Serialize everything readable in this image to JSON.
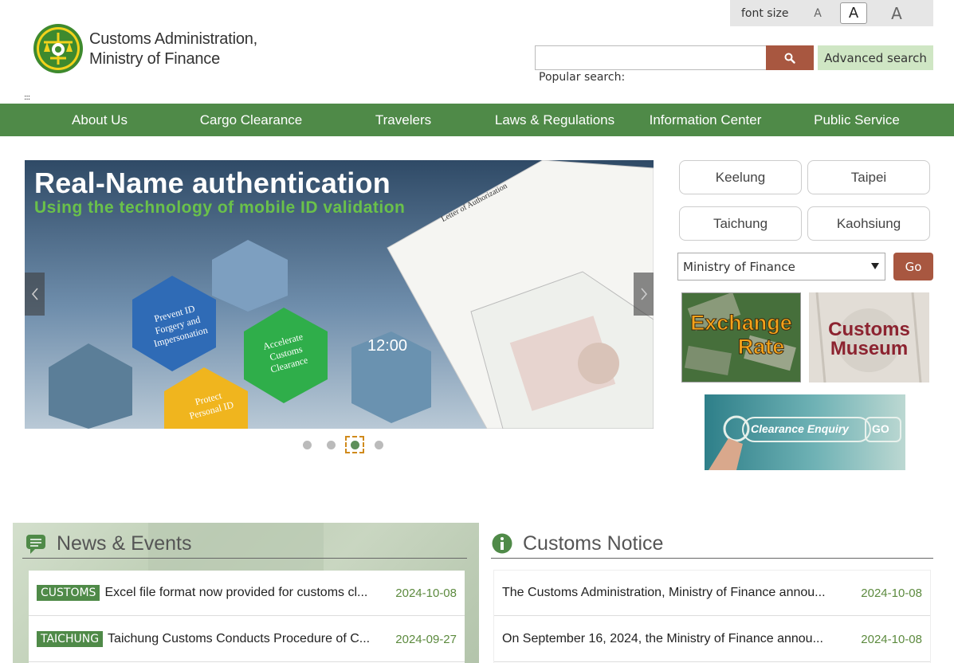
{
  "header": {
    "site_title_line1": "Customs Administration,",
    "site_title_line2": "Ministry of Finance",
    "font_size_label": "font size",
    "font_size_small": "A",
    "font_size_medium": "A",
    "font_size_large": "A",
    "search_placeholder": "",
    "advanced_search_label": "Advanced search",
    "popular_search_label": "Popular search:",
    "accesskey_label": ":::"
  },
  "nav": {
    "items": [
      {
        "label": "About Us"
      },
      {
        "label": "Cargo Clearance"
      },
      {
        "label": "Travelers"
      },
      {
        "label": "Laws & Regulations"
      },
      {
        "label": "Information Center"
      },
      {
        "label": "Public Service"
      }
    ]
  },
  "carousel": {
    "title": "Real-Name authentication",
    "subtitle": "Using the technology of mobile ID validation",
    "hex_labels": [
      "Prevent ID Forgery and Impersonation",
      "Accelerate Customs Clearance",
      "Protect Personal ID"
    ],
    "clock_text": "12:00",
    "doc_heading": "Letter of Authorization",
    "slide_count": 4,
    "active_slide": 3
  },
  "ports": {
    "keelung": "Keelung",
    "taipei": "Taipei",
    "taichung": "Taichung",
    "kaohsiung": "Kaohsiung"
  },
  "link_select": {
    "selected": "Ministry of Finance",
    "go_label": "Go"
  },
  "banners": {
    "exchange_rate_line1": "Exchange",
    "exchange_rate_line2": "Rate",
    "museum_line1": "Customs",
    "museum_line2": "Museum",
    "clearance_enquiry": "Clearance Enquiry",
    "clearance_go": "GO"
  },
  "news": {
    "heading": "News & Events",
    "items": [
      {
        "tag": "CUSTOMS",
        "title": "Excel file format now provided for customs cl...",
        "date": "2024-10-08"
      },
      {
        "tag": "TAICHUNG",
        "title": "Taichung Customs Conducts Procedure of C...",
        "date": "2024-09-27"
      }
    ]
  },
  "notice": {
    "heading": "Customs Notice",
    "items": [
      {
        "title": "The Customs Administration, Ministry of Finance annou...",
        "date": "2024-10-08"
      },
      {
        "title": "On September 16, 2024, the Ministry of Finance annou...",
        "date": "2024-10-08"
      }
    ]
  },
  "colors": {
    "nav_green": "#4f8a48",
    "brand_brown": "#a85740",
    "date_green": "#5c8a3e"
  }
}
